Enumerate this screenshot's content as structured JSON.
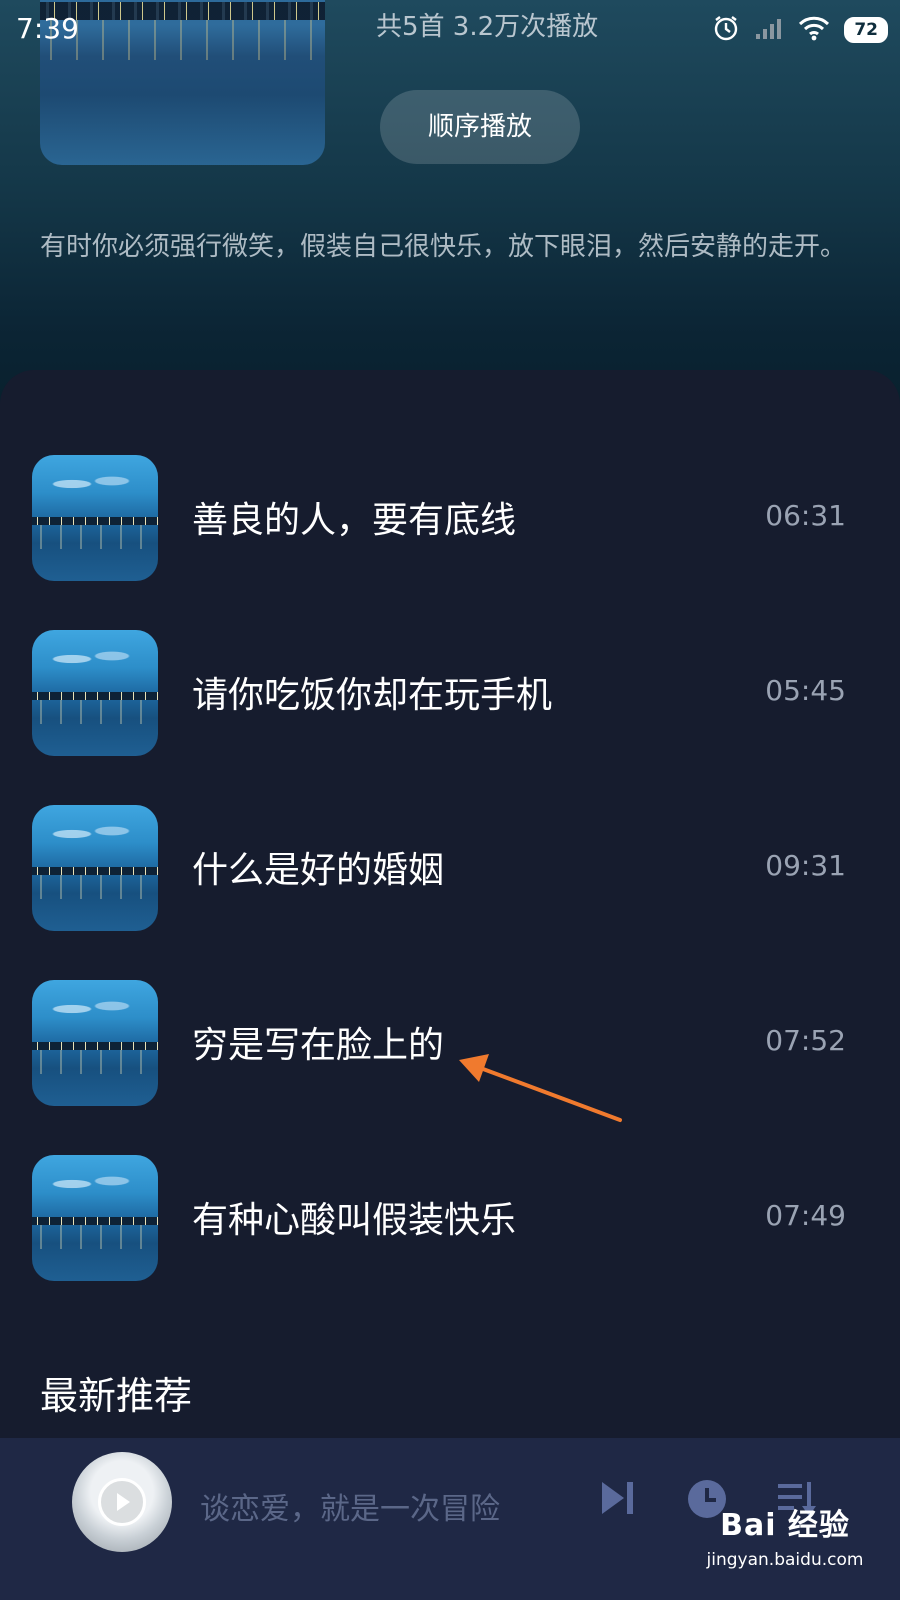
{
  "status_bar": {
    "time": "7:39",
    "battery": "72"
  },
  "album": {
    "summary": "共5首   3.2万次播放",
    "play_order_label": "顺序播放",
    "description": "有时你必须强行微笑，假装自己很快乐，放下眼泪，然后安静的走开。"
  },
  "tracks": [
    {
      "title": "善良的人，要有底线",
      "duration": "06:31"
    },
    {
      "title": "请你吃饭你却在玩手机",
      "duration": "05:45"
    },
    {
      "title": "什么是好的婚姻",
      "duration": "09:31"
    },
    {
      "title": "穷是写在脸上的",
      "duration": "07:52"
    },
    {
      "title": "有种心酸叫假装快乐",
      "duration": "07:49"
    }
  ],
  "section": {
    "latest_title": "最新推荐"
  },
  "player": {
    "now_playing": "谈恋爱，就是一次冒险"
  },
  "watermark": {
    "logo": "Bai 经验",
    "url": "jingyan.baidu.com"
  },
  "colors": {
    "background": "#161c2e",
    "player_bar": "#1f2845",
    "annotation_arrow": "#f07a2e"
  },
  "icons": [
    "alarm-icon",
    "signal-icon",
    "wifi-icon",
    "battery-icon",
    "play-icon",
    "next-icon",
    "timer-icon",
    "playlist-icon",
    "annotation-arrow"
  ]
}
